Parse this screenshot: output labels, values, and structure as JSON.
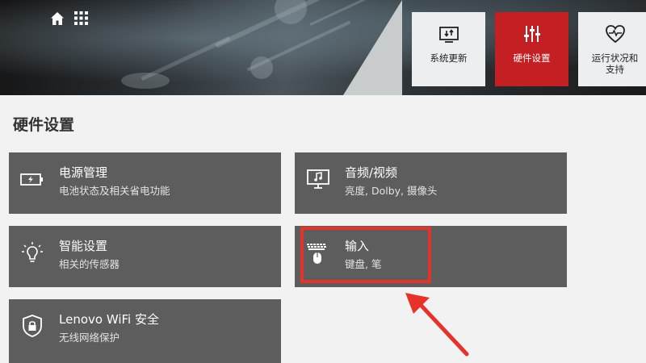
{
  "header": {
    "tiles": [
      {
        "label": "系统更新",
        "icon": "system-update-icon",
        "active": false
      },
      {
        "label": "硬件设置",
        "icon": "hardware-settings-icon",
        "active": true
      },
      {
        "label": "运行状况和\n支持",
        "icon": "health-heart-icon",
        "active": false
      }
    ]
  },
  "page": {
    "title": "硬件设置"
  },
  "cards": [
    {
      "title": "电源管理",
      "subtitle": "电池状态及相关省电功能",
      "icon": "battery-icon"
    },
    {
      "title": "音频/视频",
      "subtitle": "亮度, Dolby, 摄像头",
      "icon": "monitor-music-icon"
    },
    {
      "title": "智能设置",
      "subtitle": "相关的传感器",
      "icon": "lightbulb-icon"
    },
    {
      "title": "输入",
      "subtitle": "键盘, 笔",
      "icon": "keyboard-mouse-icon"
    },
    {
      "title": "Lenovo WiFi 安全",
      "subtitle": "无线网络保护",
      "icon": "shield-lock-icon"
    }
  ],
  "colors": {
    "accent": "#c41f22",
    "card": "#5d5d5d",
    "highlight": "#e5332c"
  }
}
